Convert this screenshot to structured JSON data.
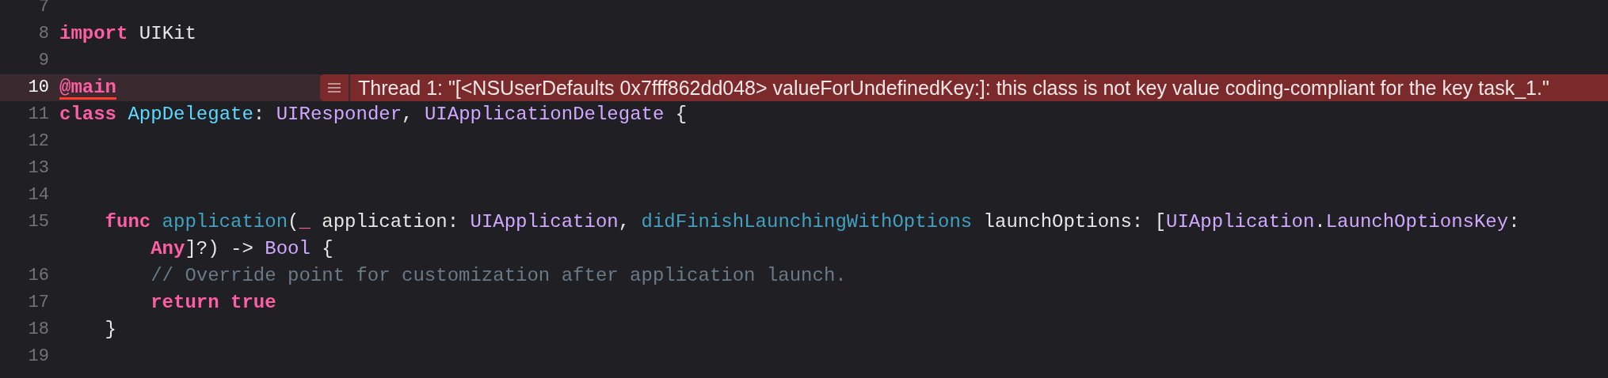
{
  "editor": {
    "lines": [
      {
        "number": "7",
        "current": false
      },
      {
        "number": "8",
        "current": false,
        "tokens": [
          {
            "kind": "keyword",
            "text": "import"
          },
          {
            "kind": "plain",
            "text": " UIKit"
          }
        ]
      },
      {
        "number": "9",
        "current": false
      },
      {
        "number": "10",
        "current": true,
        "tokens": [
          {
            "kind": "attribute",
            "text": "@main",
            "error_underline": true
          }
        ],
        "issue": {
          "kind": "error",
          "message": "Thread 1: \"[<NSUserDefaults 0x7fff862dd048> valueForUndefinedKey:]: this class is not key value coding-compliant for the key task_1.\""
        }
      },
      {
        "number": "11",
        "current": false,
        "tokens": [
          {
            "kind": "keyword",
            "text": "class "
          },
          {
            "kind": "type_decl",
            "text": "AppDelegate"
          },
          {
            "kind": "plain",
            "text": ": "
          },
          {
            "kind": "type",
            "text": "UIResponder"
          },
          {
            "kind": "plain",
            "text": ", "
          },
          {
            "kind": "type",
            "text": "UIApplicationDelegate"
          },
          {
            "kind": "plain",
            "text": " {"
          }
        ]
      },
      {
        "number": "12",
        "current": false
      },
      {
        "number": "13",
        "current": false
      },
      {
        "number": "14",
        "current": false
      },
      {
        "number": "15",
        "current": false,
        "tokens": [
          {
            "kind": "keyword",
            "text": "    func "
          },
          {
            "kind": "func",
            "text": "application"
          },
          {
            "kind": "plain",
            "text": "("
          },
          {
            "kind": "keyword",
            "text": "_"
          },
          {
            "kind": "plain",
            "text": " application: "
          },
          {
            "kind": "type",
            "text": "UIApplication"
          },
          {
            "kind": "plain",
            "text": ", "
          },
          {
            "kind": "func",
            "text": "didFinishLaunchingWithOptions"
          },
          {
            "kind": "plain",
            "text": " launchOptions: ["
          },
          {
            "kind": "type",
            "text": "UIApplication"
          },
          {
            "kind": "plain",
            "text": "."
          },
          {
            "kind": "type",
            "text": "LaunchOptionsKey"
          },
          {
            "kind": "plain",
            "text": ":"
          }
        ],
        "wrap_tokens": [
          {
            "kind": "keyword",
            "text": "        Any"
          },
          {
            "kind": "plain",
            "text": "]?) -> "
          },
          {
            "kind": "type",
            "text": "Bool"
          },
          {
            "kind": "plain",
            "text": " {"
          }
        ]
      },
      {
        "number": "16",
        "current": false,
        "tokens": [
          {
            "kind": "comment",
            "text": "        // Override point for customization after application launch."
          }
        ]
      },
      {
        "number": "17",
        "current": false,
        "tokens": [
          {
            "kind": "keyword",
            "text": "        return true"
          }
        ]
      },
      {
        "number": "18",
        "current": false,
        "tokens": [
          {
            "kind": "plain",
            "text": "    }"
          }
        ]
      },
      {
        "number": "19",
        "current": false
      }
    ]
  }
}
